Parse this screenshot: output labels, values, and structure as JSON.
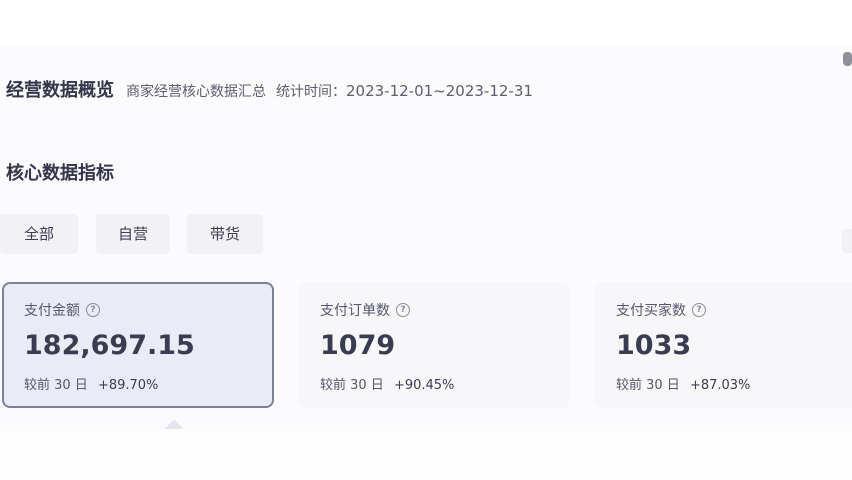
{
  "header": {
    "title": "经营数据概览",
    "subtitle": "商家经营核心数据汇总",
    "time_label": "统计时间：",
    "time_range": "2023-12-01~2023-12-31"
  },
  "section": {
    "title": "核心数据指标"
  },
  "tabs": [
    {
      "label": "全部",
      "selected": true
    },
    {
      "label": "自营",
      "selected": false
    },
    {
      "label": "带货",
      "selected": false
    }
  ],
  "cards": [
    {
      "label": "支付金额",
      "value": "182,697.15",
      "compare_label": "较前 30 日",
      "change": "+89.70%",
      "selected": true
    },
    {
      "label": "支付订单数",
      "value": "1079",
      "compare_label": "较前 30 日",
      "change": "+90.45%",
      "selected": false
    },
    {
      "label": "支付买家数",
      "value": "1033",
      "compare_label": "较前 30 日",
      "change": "+87.03%",
      "selected": false
    }
  ],
  "icons": {
    "help": "question-circle-icon"
  },
  "colors": {
    "selected_card_border": "#7d8099",
    "selected_card_bg": "#e9ebf6"
  }
}
